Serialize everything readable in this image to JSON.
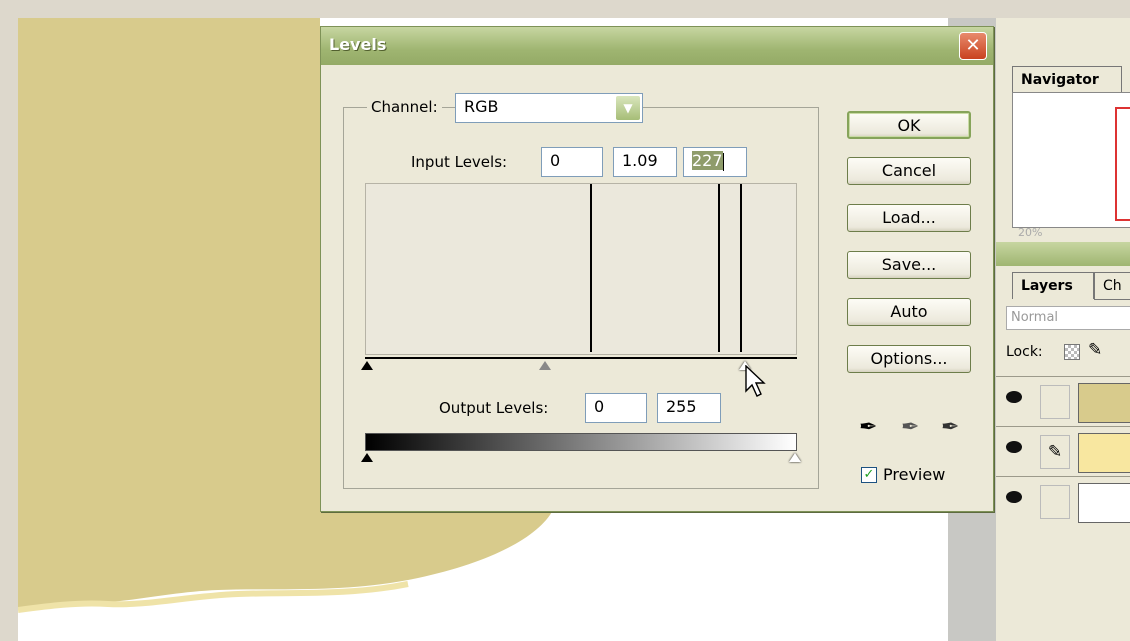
{
  "dialog": {
    "title": "Levels",
    "close_label": "✕",
    "channel_label": "Channel:",
    "channel_value": "RGB",
    "input_levels_label": "Input Levels:",
    "input_black": "0",
    "input_gamma": "1.09",
    "input_white": "227",
    "output_levels_label": "Output Levels:",
    "output_black": "0",
    "output_white": "255",
    "buttons": {
      "ok": "OK",
      "cancel": "Cancel",
      "load": "Load...",
      "save": "Save...",
      "auto": "Auto",
      "options": "Options..."
    },
    "preview_label": "Preview",
    "preview_checked": true
  },
  "palettes": {
    "navigator_tab": "Navigator",
    "zoom_text": "20%",
    "layers_tab": "Layers",
    "channels_tab": "Ch",
    "blend_mode": "Normal",
    "lock_label": "Lock:"
  },
  "colors": {
    "canvas_fill": "#d6c98a",
    "titlebar": "#9fb571",
    "dialog_bg": "#ece9d8"
  }
}
